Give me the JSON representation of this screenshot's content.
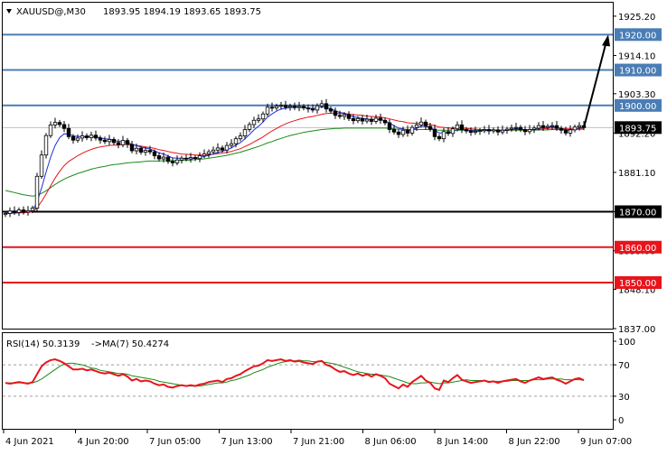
{
  "chart_data": [
    {
      "type": "candlestick",
      "title": "XAUUSD@,M30  1893.95 1894.19 1893.65 1893.75",
      "symbol_header": "XAUUSD@,M30",
      "ohlc_header": "1893.95 1894.19 1893.65 1893.75",
      "ylim": [
        1837,
        1929
      ],
      "y_ticks": [
        "1925.20",
        "1914.10",
        "1903.30",
        "1892.20",
        "1881.10",
        "1870.00",
        "1859.00",
        "1848.10",
        "1837.00"
      ],
      "x_ticks": [
        "4 Jun 2021",
        "4 Jun 20:00",
        "7 Jun 05:00",
        "7 Jun 13:00",
        "7 Jun 21:00",
        "8 Jun 06:00",
        "8 Jun 14:00",
        "8 Jun 22:00",
        "9 Jun 07:00"
      ],
      "current_price": "1893.75",
      "current_price_value": 1893.75,
      "horizontal_levels": [
        {
          "label": "1920.00",
          "value": 1920.0,
          "color": "#4a7db5"
        },
        {
          "label": "1910.00",
          "value": 1910.0,
          "color": "#4a7db5"
        },
        {
          "label": "1900.00",
          "value": 1900.0,
          "color": "#4a7db5"
        },
        {
          "label": "1870.00",
          "value": 1870.0,
          "color": "#000000"
        },
        {
          "label": "1860.00",
          "value": 1860.0,
          "color": "#e8141b"
        },
        {
          "label": "1850.00",
          "value": 1850.0,
          "color": "#e8141b"
        }
      ],
      "candles_close": [
        1869.5,
        1870.2,
        1869.8,
        1870.5,
        1869.9,
        1870.3,
        1871.0,
        1880.0,
        1886.0,
        1891.5,
        1894.5,
        1895.2,
        1894.6,
        1893.5,
        1891.2,
        1890.2,
        1890.8,
        1891.4,
        1890.9,
        1891.6,
        1890.8,
        1890.2,
        1889.8,
        1890.4,
        1889.5,
        1888.9,
        1890.1,
        1889.0,
        1887.2,
        1887.9,
        1886.8,
        1887.3,
        1886.9,
        1885.8,
        1884.9,
        1885.4,
        1884.2,
        1883.8,
        1884.6,
        1885.1,
        1884.9,
        1885.3,
        1885.0,
        1885.8,
        1886.3,
        1886.9,
        1887.4,
        1888.0,
        1887.4,
        1888.7,
        1889.2,
        1890.6,
        1891.4,
        1893.2,
        1894.6,
        1895.8,
        1896.2,
        1897.6,
        1899.5,
        1899.3,
        1899.8,
        1900.0,
        1899.5,
        1899.8,
        1899.4,
        1899.7,
        1899.3,
        1899.0,
        1898.7,
        1899.9,
        1900.5,
        1899.0,
        1898.4,
        1897.2,
        1896.9,
        1897.4,
        1896.3,
        1895.7,
        1896.3,
        1895.6,
        1896.1,
        1895.5,
        1896.4,
        1895.8,
        1895.1,
        1893.2,
        1892.5,
        1891.8,
        1893.0,
        1892.2,
        1893.8,
        1894.5,
        1895.3,
        1894.1,
        1893.3,
        1891.2,
        1890.6,
        1892.6,
        1892.1,
        1893.4,
        1894.5,
        1893.2,
        1892.8,
        1892.4,
        1892.7,
        1892.9,
        1893.2,
        1892.8,
        1893.1,
        1892.5,
        1893.0,
        1893.3,
        1893.6,
        1893.8,
        1893.2,
        1892.6,
        1893.2,
        1893.6,
        1894.3,
        1893.8,
        1894.1,
        1894.3,
        1893.5,
        1893.0,
        1892.2,
        1893.1,
        1893.9,
        1894.3,
        1893.75
      ],
      "ma_fast": [
        1869.5,
        1869.7,
        1869.7,
        1869.9,
        1869.9,
        1870.0,
        1870.2,
        1872.8,
        1876.7,
        1881.2,
        1885.4,
        1888.7,
        1890.9,
        1892.0,
        1891.9,
        1891.4,
        1891.2,
        1891.2,
        1891.1,
        1891.2,
        1891.1,
        1890.9,
        1890.6,
        1890.5,
        1890.2,
        1889.8,
        1889.9,
        1889.6,
        1889.0,
        1888.7,
        1888.2,
        1888.0,
        1887.7,
        1887.2,
        1886.6,
        1886.3,
        1885.7,
        1885.2,
        1885.1,
        1885.1,
        1885.0,
        1885.1,
        1885.1,
        1885.3,
        1885.6,
        1885.9,
        1886.3,
        1886.8,
        1887.0,
        1887.5,
        1888.0,
        1888.8,
        1889.5,
        1890.6,
        1891.8,
        1893.1,
        1894.1,
        1895.3,
        1896.7,
        1897.6,
        1898.4,
        1899.0,
        1899.2,
        1899.4,
        1899.4,
        1899.5,
        1899.4,
        1899.3,
        1899.1,
        1899.3,
        1899.6,
        1899.4,
        1899.1,
        1898.5,
        1898.0,
        1897.8,
        1897.3,
        1896.8,
        1896.6,
        1896.3,
        1896.2,
        1896.0,
        1896.1,
        1896.0,
        1895.7,
        1895.0,
        1894.3,
        1893.6,
        1893.4,
        1893.0,
        1893.2,
        1893.6,
        1894.1,
        1894.1,
        1893.8,
        1893.0,
        1892.2,
        1892.3,
        1892.2,
        1892.6,
        1893.2,
        1893.2,
        1893.1,
        1892.9,
        1892.8,
        1892.8,
        1892.9,
        1892.9,
        1893.0,
        1892.8,
        1892.9,
        1893.0,
        1893.2,
        1893.4,
        1893.4,
        1893.1,
        1893.1,
        1893.3,
        1893.6,
        1893.7,
        1893.8,
        1894.0,
        1893.8,
        1893.5,
        1893.0,
        1893.0,
        1893.3,
        1893.7,
        1893.7
      ],
      "ma_mid": [
        1869.5,
        1869.6,
        1869.6,
        1869.7,
        1869.7,
        1869.8,
        1869.9,
        1871.1,
        1872.9,
        1875.0,
        1877.3,
        1879.5,
        1881.4,
        1883.0,
        1884.2,
        1885.0,
        1885.8,
        1886.5,
        1887.1,
        1887.6,
        1888.0,
        1888.3,
        1888.5,
        1888.7,
        1888.8,
        1888.8,
        1889.0,
        1889.0,
        1888.8,
        1888.7,
        1888.5,
        1888.3,
        1888.1,
        1887.9,
        1887.5,
        1887.3,
        1887.0,
        1886.7,
        1886.5,
        1886.3,
        1886.2,
        1886.1,
        1886.0,
        1886.0,
        1886.0,
        1886.1,
        1886.2,
        1886.4,
        1886.5,
        1886.8,
        1887.0,
        1887.4,
        1887.8,
        1888.4,
        1889.0,
        1889.7,
        1890.4,
        1891.1,
        1892.0,
        1892.8,
        1893.5,
        1894.2,
        1894.8,
        1895.3,
        1895.7,
        1896.1,
        1896.4,
        1896.7,
        1896.9,
        1897.2,
        1897.5,
        1897.7,
        1897.8,
        1897.8,
        1897.7,
        1897.7,
        1897.6,
        1897.4,
        1897.3,
        1897.2,
        1897.0,
        1896.9,
        1896.8,
        1896.7,
        1896.5,
        1896.2,
        1895.9,
        1895.6,
        1895.4,
        1895.1,
        1895.0,
        1894.9,
        1894.9,
        1894.8,
        1894.6,
        1894.3,
        1893.9,
        1893.8,
        1893.6,
        1893.6,
        1893.7,
        1893.6,
        1893.5,
        1893.4,
        1893.3,
        1893.2,
        1893.2,
        1893.1,
        1893.1,
        1893.0,
        1893.0,
        1893.0,
        1893.1,
        1893.2,
        1893.2,
        1893.1,
        1893.1,
        1893.2,
        1893.3,
        1893.4,
        1893.5,
        1893.6,
        1893.6,
        1893.5,
        1893.4,
        1893.4,
        1893.4,
        1893.5,
        1893.6
      ],
      "ma_slow": [
        1876.0,
        1875.7,
        1875.4,
        1875.1,
        1874.8,
        1874.6,
        1874.4,
        1874.6,
        1875.2,
        1875.9,
        1876.8,
        1877.7,
        1878.5,
        1879.2,
        1879.8,
        1880.3,
        1880.8,
        1881.2,
        1881.6,
        1882.0,
        1882.3,
        1882.6,
        1882.8,
        1883.1,
        1883.3,
        1883.4,
        1883.6,
        1883.8,
        1883.9,
        1884.0,
        1884.1,
        1884.2,
        1884.3,
        1884.3,
        1884.3,
        1884.4,
        1884.4,
        1884.4,
        1884.4,
        1884.5,
        1884.5,
        1884.6,
        1884.7,
        1884.8,
        1884.9,
        1885.1,
        1885.3,
        1885.5,
        1885.7,
        1885.9,
        1886.2,
        1886.5,
        1886.8,
        1887.2,
        1887.6,
        1888.0,
        1888.4,
        1888.9,
        1889.4,
        1889.8,
        1890.3,
        1890.7,
        1891.1,
        1891.5,
        1891.8,
        1892.1,
        1892.4,
        1892.6,
        1892.8,
        1893.0,
        1893.2,
        1893.3,
        1893.4,
        1893.5,
        1893.5,
        1893.6,
        1893.6,
        1893.6,
        1893.6,
        1893.6,
        1893.6,
        1893.6,
        1893.6,
        1893.6,
        1893.6,
        1893.5,
        1893.4,
        1893.3,
        1893.3,
        1893.2,
        1893.2,
        1893.2,
        1893.2,
        1893.2,
        1893.2,
        1893.1,
        1893.0,
        1893.0,
        1893.0,
        1893.0,
        1893.0,
        1893.0,
        1893.0,
        1893.0,
        1893.0,
        1893.0,
        1893.0,
        1893.0,
        1893.0,
        1893.0,
        1893.0,
        1893.0,
        1893.0,
        1893.0,
        1893.0,
        1893.0,
        1893.0,
        1893.0,
        1893.1,
        1893.1,
        1893.1,
        1893.2,
        1893.2,
        1893.2,
        1893.2,
        1893.2,
        1893.2,
        1893.3,
        1893.3
      ],
      "series_colors": {
        "ma_fast": "#1b2ee0",
        "ma_mid": "#e8141b",
        "ma_slow": "#1a8a1a",
        "candles": "#000000"
      },
      "projection_arrow": {
        "from": 1893.75,
        "to": 1920.0,
        "color": "#000000"
      }
    },
    {
      "type": "line",
      "title": "RSI(14) 50.3139  ->MA(7) 50.4274",
      "rsi_header": "RSI(14) 50.3139",
      "ma_header": "->MA(7) 50.4274",
      "ylim": [
        0,
        100
      ],
      "y_ticks": [
        "100",
        "70",
        "30",
        "0"
      ],
      "dashed_levels": [
        70,
        30
      ],
      "series": [
        {
          "name": "RSI(14)",
          "color": "#e8141b",
          "values": [
            47,
            46,
            47,
            48,
            47,
            46,
            48,
            58,
            68,
            73,
            76,
            77,
            75,
            72,
            68,
            64,
            64,
            65,
            63,
            64,
            62,
            60,
            59,
            60,
            58,
            56,
            58,
            55,
            50,
            52,
            49,
            50,
            49,
            46,
            44,
            45,
            42,
            41,
            43,
            44,
            43,
            44,
            43,
            45,
            46,
            48,
            49,
            50,
            48,
            52,
            53,
            56,
            58,
            62,
            65,
            68,
            69,
            72,
            76,
            75,
            76,
            77,
            75,
            76,
            74,
            75,
            73,
            72,
            71,
            74,
            75,
            70,
            68,
            64,
            61,
            62,
            59,
            57,
            59,
            56,
            58,
            55,
            58,
            56,
            53,
            46,
            43,
            40,
            45,
            42,
            48,
            52,
            56,
            50,
            47,
            40,
            38,
            50,
            48,
            53,
            57,
            51,
            49,
            47,
            48,
            49,
            50,
            48,
            49,
            47,
            49,
            50,
            51,
            52,
            49,
            47,
            50,
            52,
            54,
            52,
            53,
            54,
            51,
            49,
            46,
            49,
            52,
            53,
            50.3139
          ]
        },
        {
          "name": "MA(7)",
          "color": "#1a8a1a",
          "values": [
            47,
            47,
            47,
            47,
            47,
            47,
            47,
            49,
            52,
            56,
            60,
            64,
            68,
            71,
            72,
            72,
            71,
            70,
            68,
            66,
            65,
            63,
            62,
            61,
            60,
            59,
            59,
            58,
            56,
            55,
            54,
            53,
            52,
            51,
            49,
            48,
            47,
            46,
            45,
            44,
            43,
            43,
            43,
            43,
            44,
            45,
            46,
            47,
            47,
            48,
            50,
            51,
            53,
            55,
            57,
            60,
            62,
            64,
            67,
            69,
            71,
            73,
            74,
            75,
            75,
            76,
            75,
            75,
            74,
            74,
            74,
            73,
            72,
            71,
            69,
            67,
            65,
            63,
            61,
            60,
            59,
            58,
            58,
            57,
            56,
            55,
            53,
            51,
            49,
            47,
            46,
            46,
            47,
            47,
            48,
            47,
            46,
            47,
            47,
            48,
            49,
            50,
            51,
            50,
            50,
            50,
            50,
            49,
            49,
            49,
            49,
            49,
            50,
            50,
            50,
            50,
            50,
            51,
            51,
            51,
            52,
            52,
            52,
            52,
            51,
            51,
            51,
            51,
            50.4274
          ]
        }
      ]
    }
  ]
}
